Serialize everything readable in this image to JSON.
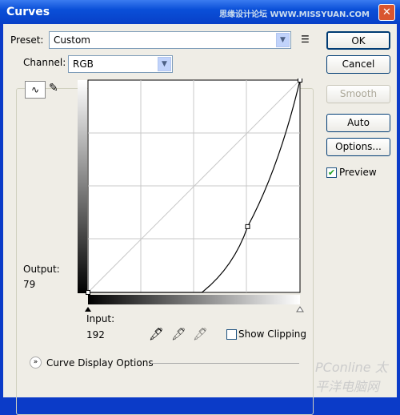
{
  "window": {
    "title": "Curves",
    "watermark": "思缘设计论坛 WWW.MISSYUAN.COM"
  },
  "preset": {
    "label": "Preset:",
    "value": "Custom"
  },
  "channel": {
    "label": "Channel:",
    "value": "RGB"
  },
  "buttons": {
    "ok": "OK",
    "cancel": "Cancel",
    "smooth": "Smooth",
    "auto": "Auto",
    "options": "Options..."
  },
  "preview": {
    "label": "Preview",
    "checked": true
  },
  "output": {
    "label": "Output:",
    "value": "79"
  },
  "input": {
    "label": "Input:",
    "value": "192"
  },
  "show_clipping": {
    "label": "Show Clipping",
    "checked": false
  },
  "curve_display_options": "Curve Display Options",
  "curve": {
    "points": [
      [
        0,
        0
      ],
      [
        192,
        79
      ],
      [
        255,
        255
      ]
    ],
    "flat_until_input": 137
  },
  "corner_watermark": "PConline 太平洋电脑网"
}
